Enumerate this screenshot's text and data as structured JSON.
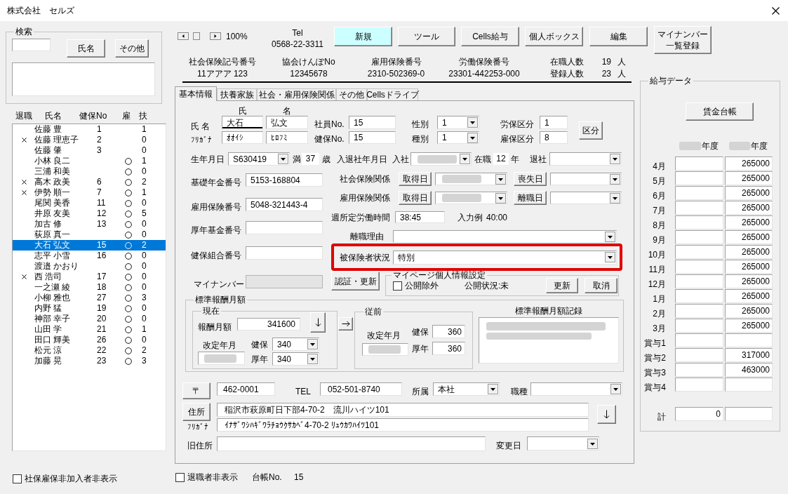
{
  "window": {
    "title": "株式会社　セルズ"
  },
  "search": {
    "legend": "検索",
    "buttons": [
      "氏名",
      "その他"
    ]
  },
  "employee_list": {
    "columns": [
      "退職",
      "氏名",
      "健保No",
      "雇",
      "扶"
    ],
    "rows": [
      {
        "retired": false,
        "name": "佐藤 豊",
        "health_no": "1",
        "employment_insured": false,
        "dependents": "1",
        "selected": false
      },
      {
        "retired": true,
        "name": "佐藤 理恵子",
        "health_no": "2",
        "employment_insured": false,
        "dependents": "0",
        "selected": false
      },
      {
        "retired": false,
        "name": "佐藤 肇",
        "health_no": "3",
        "employment_insured": false,
        "dependents": "0",
        "selected": false
      },
      {
        "retired": false,
        "name": "小林 良二",
        "employment_insured": true,
        "dependents": "1",
        "selected": false
      },
      {
        "retired": false,
        "name": "三浦 和美",
        "employment_insured": true,
        "dependents": "0",
        "selected": false
      },
      {
        "retired": true,
        "name": "高木 政美",
        "health_no": "6",
        "employment_insured": true,
        "dependents": "2",
        "selected": false
      },
      {
        "retired": true,
        "name": "伊勢 順一",
        "health_no": "7",
        "employment_insured": true,
        "dependents": "1",
        "selected": false
      },
      {
        "retired": false,
        "name": "尾関 美香",
        "health_no": "11",
        "employment_insured": true,
        "dependents": "0",
        "selected": false
      },
      {
        "retired": false,
        "name": "井原 友美",
        "health_no": "12",
        "employment_insured": true,
        "dependents": "5",
        "selected": false
      },
      {
        "retired": false,
        "name": "加古 修",
        "health_no": "13",
        "employment_insured": true,
        "dependents": "0",
        "selected": false
      },
      {
        "retired": false,
        "name": "荻原 真一",
        "employment_insured": true,
        "dependents": "0",
        "selected": false
      },
      {
        "retired": false,
        "name": "大石 弘文",
        "health_no": "15",
        "employment_insured": true,
        "dependents": "2",
        "selected": true
      },
      {
        "retired": false,
        "name": "志平 小雪",
        "health_no": "16",
        "employment_insured": true,
        "dependents": "0",
        "selected": false
      },
      {
        "retired": false,
        "name": "渡邉 かおり",
        "employment_insured": true,
        "dependents": "0",
        "selected": false
      },
      {
        "retired": true,
        "name": "西 浩司",
        "health_no": "17",
        "employment_insured": true,
        "dependents": "0",
        "selected": false
      },
      {
        "retired": false,
        "name": "一之瀬 綾",
        "health_no": "18",
        "employment_insured": true,
        "dependents": "0",
        "selected": false
      },
      {
        "retired": false,
        "name": "小柳 雅也",
        "health_no": "27",
        "employment_insured": true,
        "dependents": "3",
        "selected": false
      },
      {
        "retired": false,
        "name": "内野 猛",
        "health_no": "19",
        "employment_insured": true,
        "dependents": "0",
        "selected": false
      },
      {
        "retired": false,
        "name": "神部 幸子",
        "health_no": "20",
        "employment_insured": true,
        "dependents": "0",
        "selected": false
      },
      {
        "retired": false,
        "name": "山田 学",
        "health_no": "21",
        "employment_insured": true,
        "dependents": "1",
        "selected": false
      },
      {
        "retired": false,
        "name": "田口 輝美",
        "health_no": "26",
        "employment_insured": true,
        "dependents": "0",
        "selected": false
      },
      {
        "retired": false,
        "name": "松元 涼",
        "health_no": "22",
        "employment_insured": true,
        "dependents": "2",
        "selected": false
      },
      {
        "retired": false,
        "name": "加藤 晃",
        "health_no": "23",
        "employment_insured": true,
        "dependents": "3",
        "selected": false
      }
    ]
  },
  "hide_uninsured": {
    "label": "社保雇保非加入者非表示",
    "checked": false
  },
  "zoom": "100%",
  "tel": {
    "label": "Tel",
    "value": "0568-22-3311"
  },
  "toolbar": [
    {
      "label": "新規",
      "highlighted": true
    },
    {
      "label": "ツール",
      "highlighted": false
    },
    {
      "label": "Cells給与",
      "highlighted": false
    },
    {
      "label": "個人ボックス",
      "highlighted": false
    },
    {
      "label": "編集",
      "highlighted": false
    },
    {
      "label": "マイナンバー一覧登録",
      "highlighted": false
    }
  ],
  "company_info": [
    {
      "label": "社会保険記号番号",
      "value": "11アアア 123"
    },
    {
      "label": "協会けんぽNo",
      "value": "12345678"
    },
    {
      "label": "雇用保険番号",
      "value": "2310-502369-0"
    },
    {
      "label": "労働保険番号",
      "value": "23301-442253-000"
    }
  ],
  "headcount": [
    {
      "label": "在職人数",
      "value": "19",
      "unit": "人"
    },
    {
      "label": "登録人数",
      "value": "23",
      "unit": "人"
    }
  ],
  "tabs": [
    {
      "label": "基本情報",
      "selected": true
    },
    {
      "label": "扶養家族",
      "selected": false
    },
    {
      "label": "社会・雇用保険関係",
      "selected": false
    },
    {
      "label": "その他",
      "selected": false
    },
    {
      "label": "Cellsドライブ",
      "selected": false
    }
  ],
  "basic_info": {
    "name_headers": [
      "氏",
      "名"
    ],
    "name_label": "氏 名",
    "name": [
      {
        "value": "大石",
        "focused": true
      },
      {
        "value": "弘文",
        "focused": false
      }
    ],
    "kana_label": "ﾌﾘｶﾞﾅ",
    "kana": [
      "ｵｵｲｼ",
      "ﾋﾛﾌﾐ"
    ],
    "employee_no": {
      "label": "社員No.",
      "value": "15"
    },
    "health_no": {
      "label": "健保No.",
      "value": "15"
    },
    "gender": {
      "label": "性別",
      "value": "1"
    },
    "category": {
      "label": "種別",
      "value": "1"
    },
    "labor_insurance_class": {
      "label": "労保区分",
      "value": "1"
    },
    "employment_insurance_class": {
      "label": "雇保区分",
      "value": "8"
    },
    "class_button": "区分",
    "birth_date": {
      "label": "生年月日",
      "value": "S630419"
    },
    "age": {
      "prefix": "満",
      "value": "37",
      "unit": "歳"
    },
    "hire_dates_label": "入退社年月日",
    "hire_date": {
      "label": "入社",
      "blurred": true
    },
    "tenure": {
      "prefix": "在職",
      "value": "12",
      "unit": "年"
    },
    "leave_date": {
      "label": "退社"
    },
    "ids": [
      {
        "label": "基礎年金番号",
        "value": "5153-168804",
        "disabled": false
      },
      {
        "label": "雇用保険番号",
        "value": "5048-321443-4",
        "disabled": false
      },
      {
        "label": "厚年基金番号",
        "disabled": false
      },
      {
        "label": "健保組合番号",
        "disabled": false
      },
      {
        "label": "マイナンバー",
        "disabled": true
      }
    ],
    "insurance": [
      {
        "label": "社会保険関係",
        "acquired_button": "取得日",
        "acquired_blurred": true,
        "lost_button": "喪失日"
      },
      {
        "label": "雇用保険関係",
        "acquired_button": "取得日",
        "acquired_blurred": true,
        "lost_button": "離職日"
      }
    ],
    "weekly_hours": {
      "label": "週所定労働時間",
      "value": "38:45",
      "hint": "入力例",
      "example": "40:00"
    },
    "separation_reason": {
      "label": "離職理由"
    },
    "insured_status": {
      "label": "被保険者状況",
      "value": "特別",
      "highlighted": true
    },
    "verify_button": "認証・更新",
    "mypage": {
      "legend": "マイページ個人情報設定",
      "exclude": {
        "label": "公開除外",
        "checked": false
      },
      "status": "公開状況:未",
      "buttons": [
        "更新",
        "取消"
      ]
    }
  },
  "standard_pay": {
    "legend": "標準報酬月額",
    "current": {
      "legend": "現在",
      "pay_label": "報酬月額",
      "pay": "341600",
      "revised_label": "改定年月",
      "revised_blurred": true,
      "health": {
        "label": "健保",
        "value": "340"
      },
      "pension": {
        "label": "厚年",
        "value": "340"
      }
    },
    "previous": {
      "legend": "従前",
      "revised_label": "改定年月",
      "revised_blurred": true,
      "health": {
        "label": "健保",
        "value": "360"
      },
      "pension": {
        "label": "厚年",
        "value": "360"
      }
    },
    "record": {
      "label": "標準報酬月額記録",
      "blurred": true
    }
  },
  "address": {
    "postal_button": "〒",
    "postal_code": "462-0001",
    "tel": {
      "label": "TEL",
      "value": "052-501-8740"
    },
    "department": {
      "label": "所属",
      "value": "本社"
    },
    "job_type": {
      "label": "職種"
    },
    "address_button": "住所",
    "address": "稲沢市萩原町日下部4-70-2　流川ハイツ101",
    "kana_label": "ﾌﾘｶﾞﾅ",
    "kana": "ｲﾅｻﾞﾜｼﾊｷﾞﾜﾗﾁｮｳｸｻｶﾍﾞ4-70-2 ﾘｭｳｶﾜﾊｲﾂ101",
    "old_address": {
      "label": "旧住所"
    },
    "changed_date": {
      "label": "変更日"
    }
  },
  "footer": {
    "hide_retired": {
      "label": "退職者非表示",
      "checked": false
    },
    "ledger_label": "台帳No.",
    "ledger_no": "15"
  },
  "salary": {
    "legend": "給与データ",
    "ledger_button": "賃金台帳",
    "years": [
      {
        "blurred": true,
        "suffix": "年度"
      },
      {
        "blurred": true,
        "suffix": "年度"
      }
    ],
    "rows": [
      {
        "label": "4月",
        "column_2": "265000"
      },
      {
        "label": "5月",
        "column_2": "265000"
      },
      {
        "label": "6月",
        "column_2": "265000"
      },
      {
        "label": "7月",
        "column_2": "265000"
      },
      {
        "label": "8月",
        "column_2": "265000"
      },
      {
        "label": "9月",
        "column_2": "265000"
      },
      {
        "label": "10月",
        "column_2": "265000"
      },
      {
        "label": "11月",
        "column_2": "265000"
      },
      {
        "label": "12月",
        "column_2": "265000"
      },
      {
        "label": "1月",
        "column_2": "265000"
      },
      {
        "label": "2月",
        "column_2": "265000"
      },
      {
        "label": "3月",
        "column_2": "265000"
      },
      {
        "label": "賞与1"
      },
      {
        "label": "賞与2",
        "column_2": "317000"
      },
      {
        "label": "賞与3",
        "column_2": "463000"
      },
      {
        "label": "賞与4"
      }
    ],
    "total": {
      "label": "計",
      "column_1": "0"
    }
  }
}
